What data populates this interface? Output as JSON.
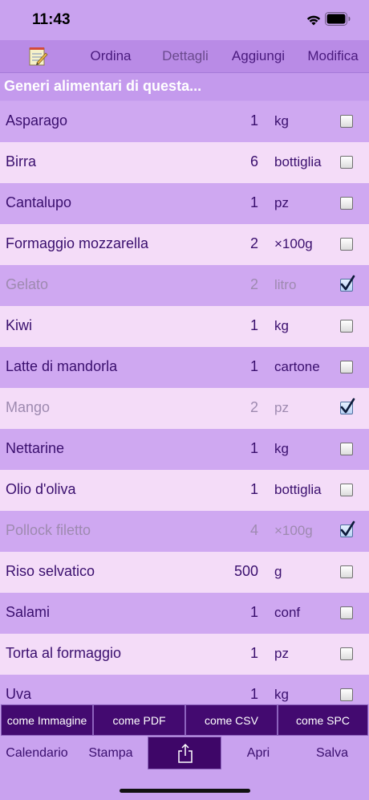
{
  "status": {
    "time": "11:43"
  },
  "toolbar": {
    "notepad_icon": "notepad-icon",
    "sort_label": "Ordina",
    "details_label": "Dettagli",
    "add_label": "Aggiungi",
    "edit_label": "Modifica"
  },
  "section": {
    "title": "Generi alimentari di questa..."
  },
  "items": [
    {
      "name": "Asparago",
      "qty": "1",
      "unit": "kg",
      "checked": false
    },
    {
      "name": "Birra",
      "qty": "6",
      "unit": "bottiglia",
      "checked": false
    },
    {
      "name": "Cantalupo",
      "qty": "1",
      "unit": "pz",
      "checked": false
    },
    {
      "name": "Formaggio mozzarella",
      "qty": "2",
      "unit": "×100g",
      "checked": false
    },
    {
      "name": "Gelato",
      "qty": "2",
      "unit": "litro",
      "checked": true
    },
    {
      "name": "Kiwi",
      "qty": "1",
      "unit": "kg",
      "checked": false
    },
    {
      "name": "Latte di mandorla",
      "qty": "1",
      "unit": "cartone",
      "checked": false
    },
    {
      "name": "Mango",
      "qty": "2",
      "unit": "pz",
      "checked": true
    },
    {
      "name": "Nettarine",
      "qty": "1",
      "unit": "kg",
      "checked": false
    },
    {
      "name": "Olio d'oliva",
      "qty": "1",
      "unit": "bottiglia",
      "checked": false
    },
    {
      "name": "Pollock filetto",
      "qty": "4",
      "unit": "×100g",
      "checked": true
    },
    {
      "name": "Riso selvatico",
      "qty": "500",
      "unit": "g",
      "checked": false
    },
    {
      "name": "Salami",
      "qty": "1",
      "unit": "conf",
      "checked": false
    },
    {
      "name": "Torta al formaggio",
      "qty": "1",
      "unit": "pz",
      "checked": false
    },
    {
      "name": "Uva",
      "qty": "1",
      "unit": "kg",
      "checked": false
    }
  ],
  "export": {
    "image_label": "come Immagine",
    "pdf_label": "come PDF",
    "csv_label": "come CSV",
    "spc_label": "come SPC"
  },
  "bottom": {
    "calendar_label": "Calendario",
    "print_label": "Stampa",
    "share_icon": "share-icon",
    "open_label": "Apri",
    "save_label": "Salva"
  }
}
